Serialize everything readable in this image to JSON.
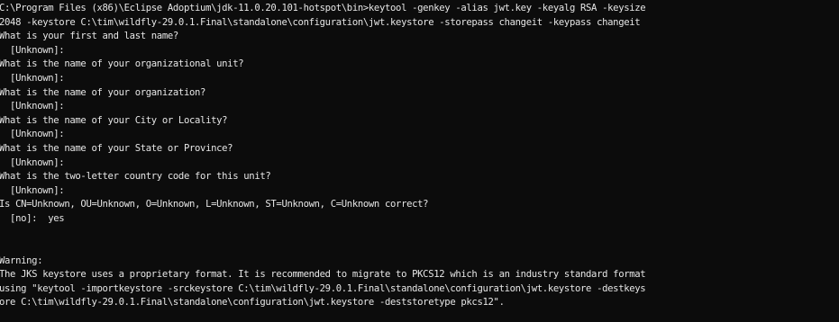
{
  "console": {
    "lines": [
      "C:\\Program Files (x86)\\Eclipse Adoptium\\jdk-11.0.20.101-hotspot\\bin>keytool -genkey -alias jwt.key -keyalg RSA -keysize",
      "2048 -keystore C:\\tim\\wildfly-29.0.1.Final\\standalone\\configuration\\jwt.keystore -storepass changeit -keypass changeit",
      "What is your first and last name?",
      "  [Unknown]:",
      "What is the name of your organizational unit?",
      "  [Unknown]:",
      "What is the name of your organization?",
      "  [Unknown]:",
      "What is the name of your City or Locality?",
      "  [Unknown]:",
      "What is the name of your State or Province?",
      "  [Unknown]:",
      "What is the two-letter country code for this unit?",
      "  [Unknown]:",
      "Is CN=Unknown, OU=Unknown, O=Unknown, L=Unknown, ST=Unknown, C=Unknown correct?",
      "  [no]:  yes",
      "",
      "",
      "Warning:",
      "The JKS keystore uses a proprietary format. It is recommended to migrate to PKCS12 which is an industry standard format",
      "using \"keytool -importkeystore -srckeystore C:\\tim\\wildfly-29.0.1.Final\\standalone\\configuration\\jwt.keystore -destkeys",
      "ore C:\\tim\\wildfly-29.0.1.Final\\standalone\\configuration\\jwt.keystore -deststoretype pkcs12\"."
    ]
  }
}
